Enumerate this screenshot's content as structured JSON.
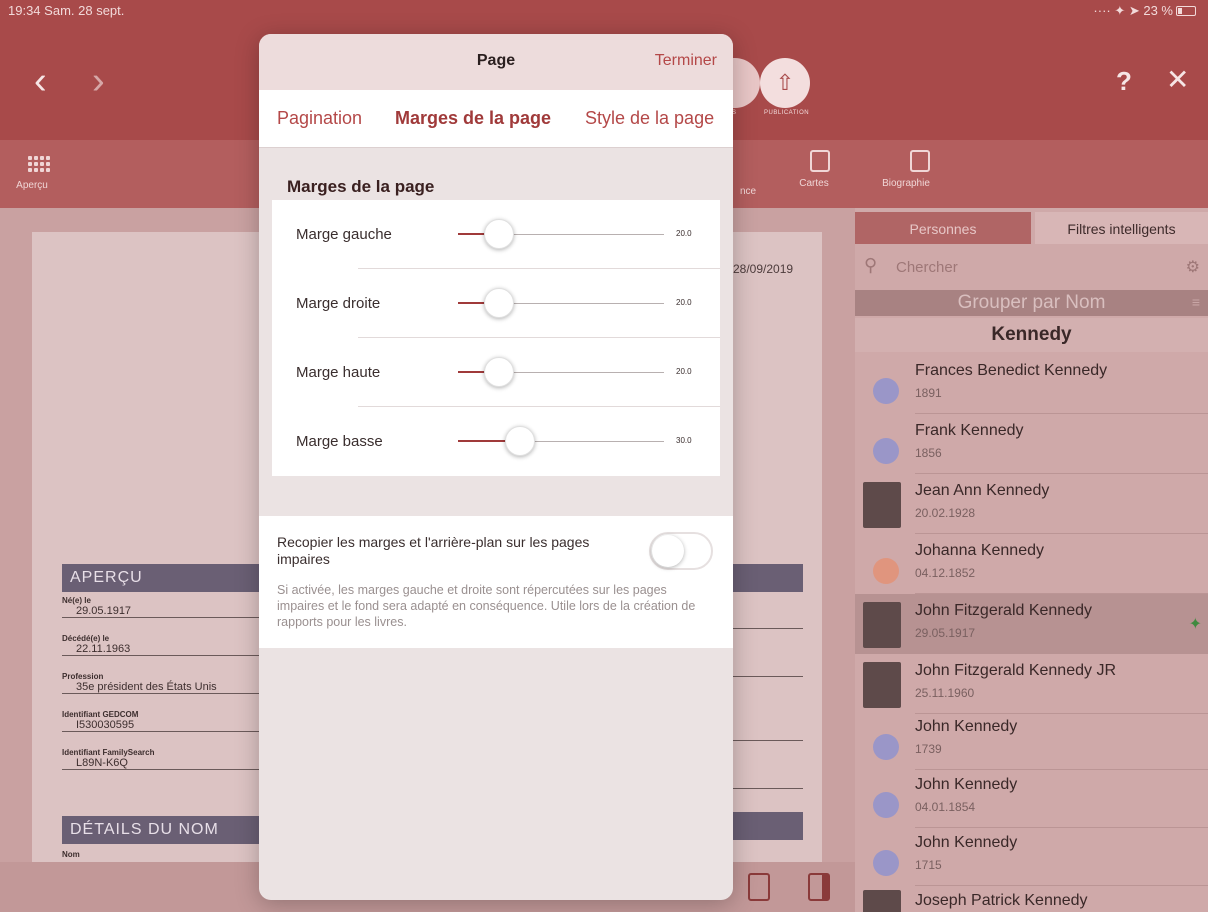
{
  "status": {
    "time": "19:34",
    "date": "Sam. 28 sept.",
    "battery": "23 %"
  },
  "nav": {
    "back": "‹",
    "forward": "›",
    "help": "?",
    "close": "✕",
    "publication_label": "PUBLICATION"
  },
  "toolbar": {
    "apercu": "Aperçu",
    "cartes": "Cartes",
    "biographie": "Biographie",
    "partial": "nce"
  },
  "document": {
    "date": "28/09/2019",
    "apercu_title": "APERÇU",
    "fields": [
      {
        "label": "Né(e) le",
        "value": "29.05.1917"
      },
      {
        "label": "Décédé(e) le",
        "value": "22.11.1963"
      },
      {
        "label": "Profession",
        "value": "35e président des États Unis"
      },
      {
        "label": "Identifiant GEDCOM",
        "value": "I530030595"
      },
      {
        "label": "Identifiant FamilySearch",
        "value": "L89N-K6Q"
      }
    ],
    "details_title": "DÉTAILS DU NOM",
    "nom_label": "Nom"
  },
  "modal": {
    "title": "Page",
    "done": "Terminer",
    "tabs": [
      "Pagination",
      "Marges de la page",
      "Style de la page"
    ],
    "active_tab": 1,
    "section_title": "Marges de la page",
    "sliders": [
      {
        "label": "Marge gauche",
        "value": "20.0",
        "level": 0.2
      },
      {
        "label": "Marge droite",
        "value": "20.0",
        "level": 0.2
      },
      {
        "label": "Marge haute",
        "value": "20.0",
        "level": 0.2
      },
      {
        "label": "Marge basse",
        "value": "30.0",
        "level": 0.3
      }
    ],
    "toggle_label": "Recopier les marges et l'arrière-plan sur les pages impaires",
    "toggle_on": false,
    "toggle_desc": "Si activée, les marges gauche et droite sont répercutées sur les pages impaires et le fond sera adapté en conséquence. Utile lors de la création de rapports pour les livres."
  },
  "sidebar": {
    "tabs": [
      "Personnes",
      "Filtres intelligents"
    ],
    "search_placeholder": "Chercher",
    "group_label": "Grouper par Nom",
    "group_name": "Kennedy",
    "persons": [
      {
        "name": "Frances Benedict Kennedy",
        "date": "1891",
        "avatar": "dot",
        "color": "#9a96c8"
      },
      {
        "name": "Frank Kennedy",
        "date": "1856",
        "avatar": "dot",
        "color": "#9a96c8"
      },
      {
        "name": "Jean Ann Kennedy",
        "date": "20.02.1928",
        "avatar": "photo"
      },
      {
        "name": "Johanna Kennedy",
        "date": "04.12.1852",
        "avatar": "dot",
        "color": "#e0957e"
      },
      {
        "name": "John Fitzgerald Kennedy",
        "date": "29.05.1917",
        "avatar": "photo",
        "selected": true
      },
      {
        "name": "John Fitzgerald Kennedy JR",
        "date": "25.11.1960",
        "avatar": "photo"
      },
      {
        "name": "John Kennedy",
        "date": "1739",
        "avatar": "dot",
        "color": "#9a96c8"
      },
      {
        "name": "John Kennedy",
        "date": "04.01.1854",
        "avatar": "dot",
        "color": "#9a96c8"
      },
      {
        "name": "John Kennedy",
        "date": "1715",
        "avatar": "dot",
        "color": "#9a96c8"
      },
      {
        "name": "Joseph Patrick Kennedy",
        "date": "",
        "avatar": "photo"
      }
    ]
  }
}
